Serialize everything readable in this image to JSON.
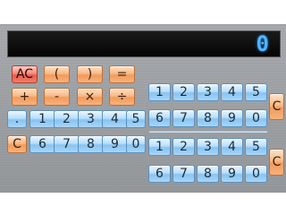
{
  "display": {
    "value": "0"
  },
  "left_top_rows": [
    [
      "AC",
      "(",
      ")",
      "="
    ],
    [
      "+",
      "-",
      "×",
      "÷"
    ]
  ],
  "left_digit_row_1": [
    ".",
    "1",
    "2",
    "3",
    "4",
    "5"
  ],
  "left_digit_row_2": [
    "C",
    "6",
    "7",
    "8",
    "9",
    "0"
  ],
  "right_block_1": {
    "row_a": [
      "1",
      "2",
      "3",
      "4",
      "5"
    ],
    "row_b": [
      "6",
      "7",
      "8",
      "9",
      "0"
    ],
    "clear": "C"
  },
  "right_block_2": {
    "row_a": [
      "1",
      "2",
      "3",
      "4",
      "5"
    ],
    "row_b": [
      "6",
      "7",
      "8",
      "9",
      "0"
    ],
    "clear": "C"
  },
  "colors": {
    "display_digits": "#4fb3ff",
    "key_blue": "#a9d6f8",
    "key_orange": "#f29b5c",
    "key_red": "#e85d4c"
  }
}
